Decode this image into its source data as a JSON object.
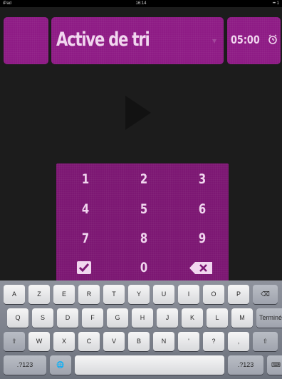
{
  "status_bar": {
    "carrier": "iPad",
    "time": "16:14",
    "battery": "•• 1 "
  },
  "header": {
    "title": "Active de tri",
    "timer": "05:00"
  },
  "keypad": {
    "rows": [
      [
        "1",
        "2",
        "3"
      ],
      [
        "4",
        "5",
        "6"
      ],
      [
        "7",
        "8",
        "9"
      ],
      [
        "",
        "0",
        ""
      ]
    ]
  },
  "keyboard": {
    "row1": [
      "A",
      "Z",
      "E",
      "R",
      "T",
      "Y",
      "U",
      "I",
      "O",
      "P",
      "⌫"
    ],
    "row2": [
      "Q",
      "S",
      "D",
      "F",
      "G",
      "H",
      "J",
      "K",
      "L",
      "M",
      "Terminé"
    ],
    "row3": [
      "⇧",
      "W",
      "X",
      "C",
      "V",
      "B",
      "N",
      "'",
      "?",
      ",",
      "⇧"
    ],
    "row4": [
      ".?123",
      "🌐",
      "",
      ".?123",
      "⌨"
    ]
  },
  "colors": {
    "accent": "#8e1b85",
    "keypad": "#7c1773",
    "text": "#f1d6ef",
    "background": "#1c1c1c"
  },
  "icons": {
    "play": "play-icon",
    "clock": "clock-icon",
    "confirm": "check-icon",
    "delete": "backspace-icon"
  }
}
